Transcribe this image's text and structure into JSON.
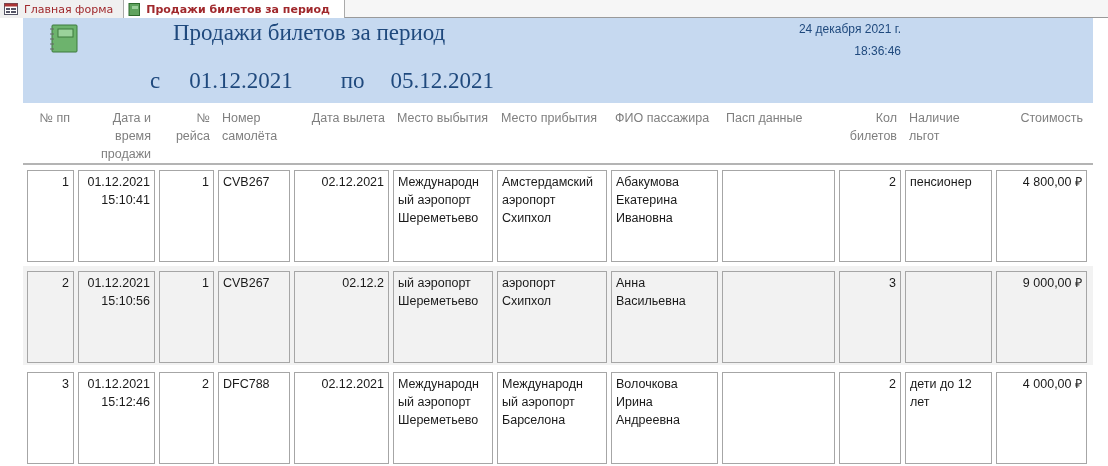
{
  "tabs": [
    {
      "label": "Главная форма",
      "kind": "form",
      "selected": false
    },
    {
      "label": "Продажи билетов за период",
      "kind": "report",
      "selected": true
    }
  ],
  "report": {
    "title": "Продажи билетов за период",
    "date": "24 декабря 2021 г.",
    "time": "18:36:46",
    "from_label": "с",
    "from": "01.12.2021",
    "to_label": "по",
    "to": "05.12.2021"
  },
  "table": {
    "columns": [
      "№ пп",
      "Дата и время продажи",
      "№ рейса",
      "Номер самолёта",
      "Дата вылета",
      "Место выбытия",
      "Место прибытия",
      "ФИО пассажира",
      "Пасп данные",
      "Кол билетов",
      "Наличие льгот",
      "Стоимость"
    ],
    "rows": [
      {
        "selected": false,
        "cells": [
          "1",
          "01.12.2021\n15:10:41",
          "1",
          "CVB267",
          "02.12.2021",
          "Международн\nый аэропорт\nШереметьево",
          "Амстердамский\nаэропорт\nСхипхол",
          "Абакумова\nЕкатерина\nИвановна",
          "",
          "2",
          "пенсионер",
          "4 800,00 ₽"
        ]
      },
      {
        "selected": true,
        "cells": [
          "2",
          "01.12.2021\n15:10:56",
          "1",
          "CVB267",
          "02.12.2",
          "ый аэропорт\nШереметьево",
          "аэропорт\nСхипхол",
          "Анна\nВасильевна",
          "",
          "3",
          "",
          "9 000,00 ₽"
        ]
      },
      {
        "selected": false,
        "cells": [
          "3",
          "01.12.2021\n15:12:46",
          "2",
          "DFC788",
          "02.12.2021",
          "Международн\nый аэропорт\nШереметьево",
          "Международн\nый аэропорт\nБарселона",
          "Волочкова\nИрина\nАндреевна",
          "",
          "2",
          "дети до 12\nлет",
          "4 000,00 ₽"
        ]
      }
    ]
  }
}
